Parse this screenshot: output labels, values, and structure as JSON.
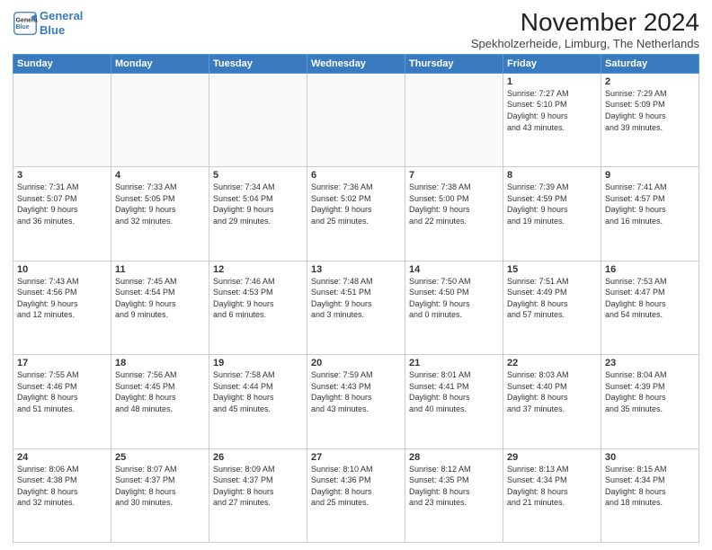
{
  "header": {
    "logo_line1": "General",
    "logo_line2": "Blue",
    "month": "November 2024",
    "location": "Spekholzerheide, Limburg, The Netherlands"
  },
  "weekdays": [
    "Sunday",
    "Monday",
    "Tuesday",
    "Wednesday",
    "Thursday",
    "Friday",
    "Saturday"
  ],
  "weeks": [
    [
      {
        "day": "",
        "info": ""
      },
      {
        "day": "",
        "info": ""
      },
      {
        "day": "",
        "info": ""
      },
      {
        "day": "",
        "info": ""
      },
      {
        "day": "",
        "info": ""
      },
      {
        "day": "1",
        "info": "Sunrise: 7:27 AM\nSunset: 5:10 PM\nDaylight: 9 hours\nand 43 minutes."
      },
      {
        "day": "2",
        "info": "Sunrise: 7:29 AM\nSunset: 5:09 PM\nDaylight: 9 hours\nand 39 minutes."
      }
    ],
    [
      {
        "day": "3",
        "info": "Sunrise: 7:31 AM\nSunset: 5:07 PM\nDaylight: 9 hours\nand 36 minutes."
      },
      {
        "day": "4",
        "info": "Sunrise: 7:33 AM\nSunset: 5:05 PM\nDaylight: 9 hours\nand 32 minutes."
      },
      {
        "day": "5",
        "info": "Sunrise: 7:34 AM\nSunset: 5:04 PM\nDaylight: 9 hours\nand 29 minutes."
      },
      {
        "day": "6",
        "info": "Sunrise: 7:36 AM\nSunset: 5:02 PM\nDaylight: 9 hours\nand 25 minutes."
      },
      {
        "day": "7",
        "info": "Sunrise: 7:38 AM\nSunset: 5:00 PM\nDaylight: 9 hours\nand 22 minutes."
      },
      {
        "day": "8",
        "info": "Sunrise: 7:39 AM\nSunset: 4:59 PM\nDaylight: 9 hours\nand 19 minutes."
      },
      {
        "day": "9",
        "info": "Sunrise: 7:41 AM\nSunset: 4:57 PM\nDaylight: 9 hours\nand 16 minutes."
      }
    ],
    [
      {
        "day": "10",
        "info": "Sunrise: 7:43 AM\nSunset: 4:56 PM\nDaylight: 9 hours\nand 12 minutes."
      },
      {
        "day": "11",
        "info": "Sunrise: 7:45 AM\nSunset: 4:54 PM\nDaylight: 9 hours\nand 9 minutes."
      },
      {
        "day": "12",
        "info": "Sunrise: 7:46 AM\nSunset: 4:53 PM\nDaylight: 9 hours\nand 6 minutes."
      },
      {
        "day": "13",
        "info": "Sunrise: 7:48 AM\nSunset: 4:51 PM\nDaylight: 9 hours\nand 3 minutes."
      },
      {
        "day": "14",
        "info": "Sunrise: 7:50 AM\nSunset: 4:50 PM\nDaylight: 9 hours\nand 0 minutes."
      },
      {
        "day": "15",
        "info": "Sunrise: 7:51 AM\nSunset: 4:49 PM\nDaylight: 8 hours\nand 57 minutes."
      },
      {
        "day": "16",
        "info": "Sunrise: 7:53 AM\nSunset: 4:47 PM\nDaylight: 8 hours\nand 54 minutes."
      }
    ],
    [
      {
        "day": "17",
        "info": "Sunrise: 7:55 AM\nSunset: 4:46 PM\nDaylight: 8 hours\nand 51 minutes."
      },
      {
        "day": "18",
        "info": "Sunrise: 7:56 AM\nSunset: 4:45 PM\nDaylight: 8 hours\nand 48 minutes."
      },
      {
        "day": "19",
        "info": "Sunrise: 7:58 AM\nSunset: 4:44 PM\nDaylight: 8 hours\nand 45 minutes."
      },
      {
        "day": "20",
        "info": "Sunrise: 7:59 AM\nSunset: 4:43 PM\nDaylight: 8 hours\nand 43 minutes."
      },
      {
        "day": "21",
        "info": "Sunrise: 8:01 AM\nSunset: 4:41 PM\nDaylight: 8 hours\nand 40 minutes."
      },
      {
        "day": "22",
        "info": "Sunrise: 8:03 AM\nSunset: 4:40 PM\nDaylight: 8 hours\nand 37 minutes."
      },
      {
        "day": "23",
        "info": "Sunrise: 8:04 AM\nSunset: 4:39 PM\nDaylight: 8 hours\nand 35 minutes."
      }
    ],
    [
      {
        "day": "24",
        "info": "Sunrise: 8:06 AM\nSunset: 4:38 PM\nDaylight: 8 hours\nand 32 minutes."
      },
      {
        "day": "25",
        "info": "Sunrise: 8:07 AM\nSunset: 4:37 PM\nDaylight: 8 hours\nand 30 minutes."
      },
      {
        "day": "26",
        "info": "Sunrise: 8:09 AM\nSunset: 4:37 PM\nDaylight: 8 hours\nand 27 minutes."
      },
      {
        "day": "27",
        "info": "Sunrise: 8:10 AM\nSunset: 4:36 PM\nDaylight: 8 hours\nand 25 minutes."
      },
      {
        "day": "28",
        "info": "Sunrise: 8:12 AM\nSunset: 4:35 PM\nDaylight: 8 hours\nand 23 minutes."
      },
      {
        "day": "29",
        "info": "Sunrise: 8:13 AM\nSunset: 4:34 PM\nDaylight: 8 hours\nand 21 minutes."
      },
      {
        "day": "30",
        "info": "Sunrise: 8:15 AM\nSunset: 4:34 PM\nDaylight: 8 hours\nand 18 minutes."
      }
    ]
  ]
}
